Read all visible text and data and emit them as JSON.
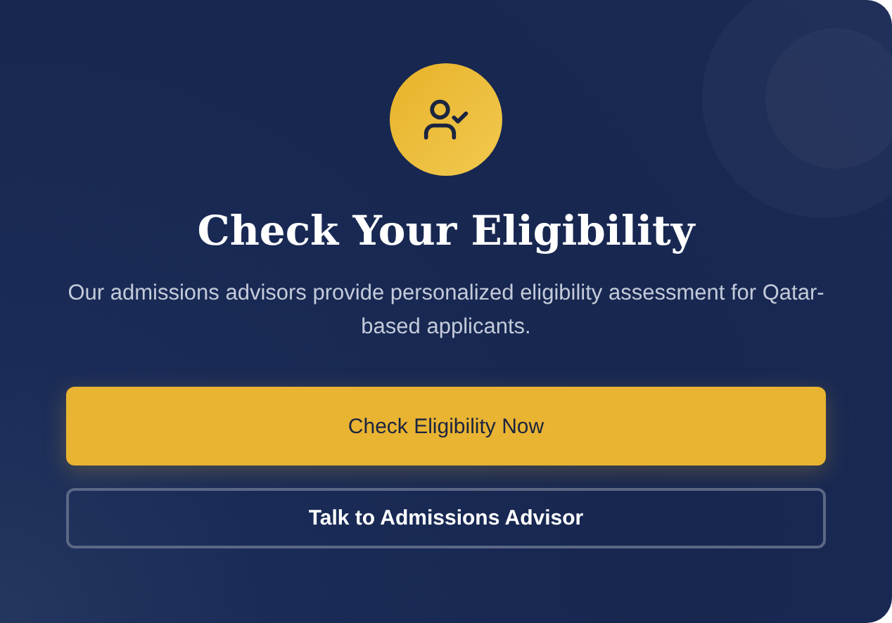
{
  "card": {
    "title": "Check Your Eligibility",
    "description": "Our admissions advisors provide personalized eligibility assessment for Qatar-based applicants.",
    "buttons": [
      {
        "label": "Check Eligibility Now",
        "kind": "primary"
      },
      {
        "label": "Talk to Admissions Advisor",
        "kind": "outline"
      }
    ]
  }
}
